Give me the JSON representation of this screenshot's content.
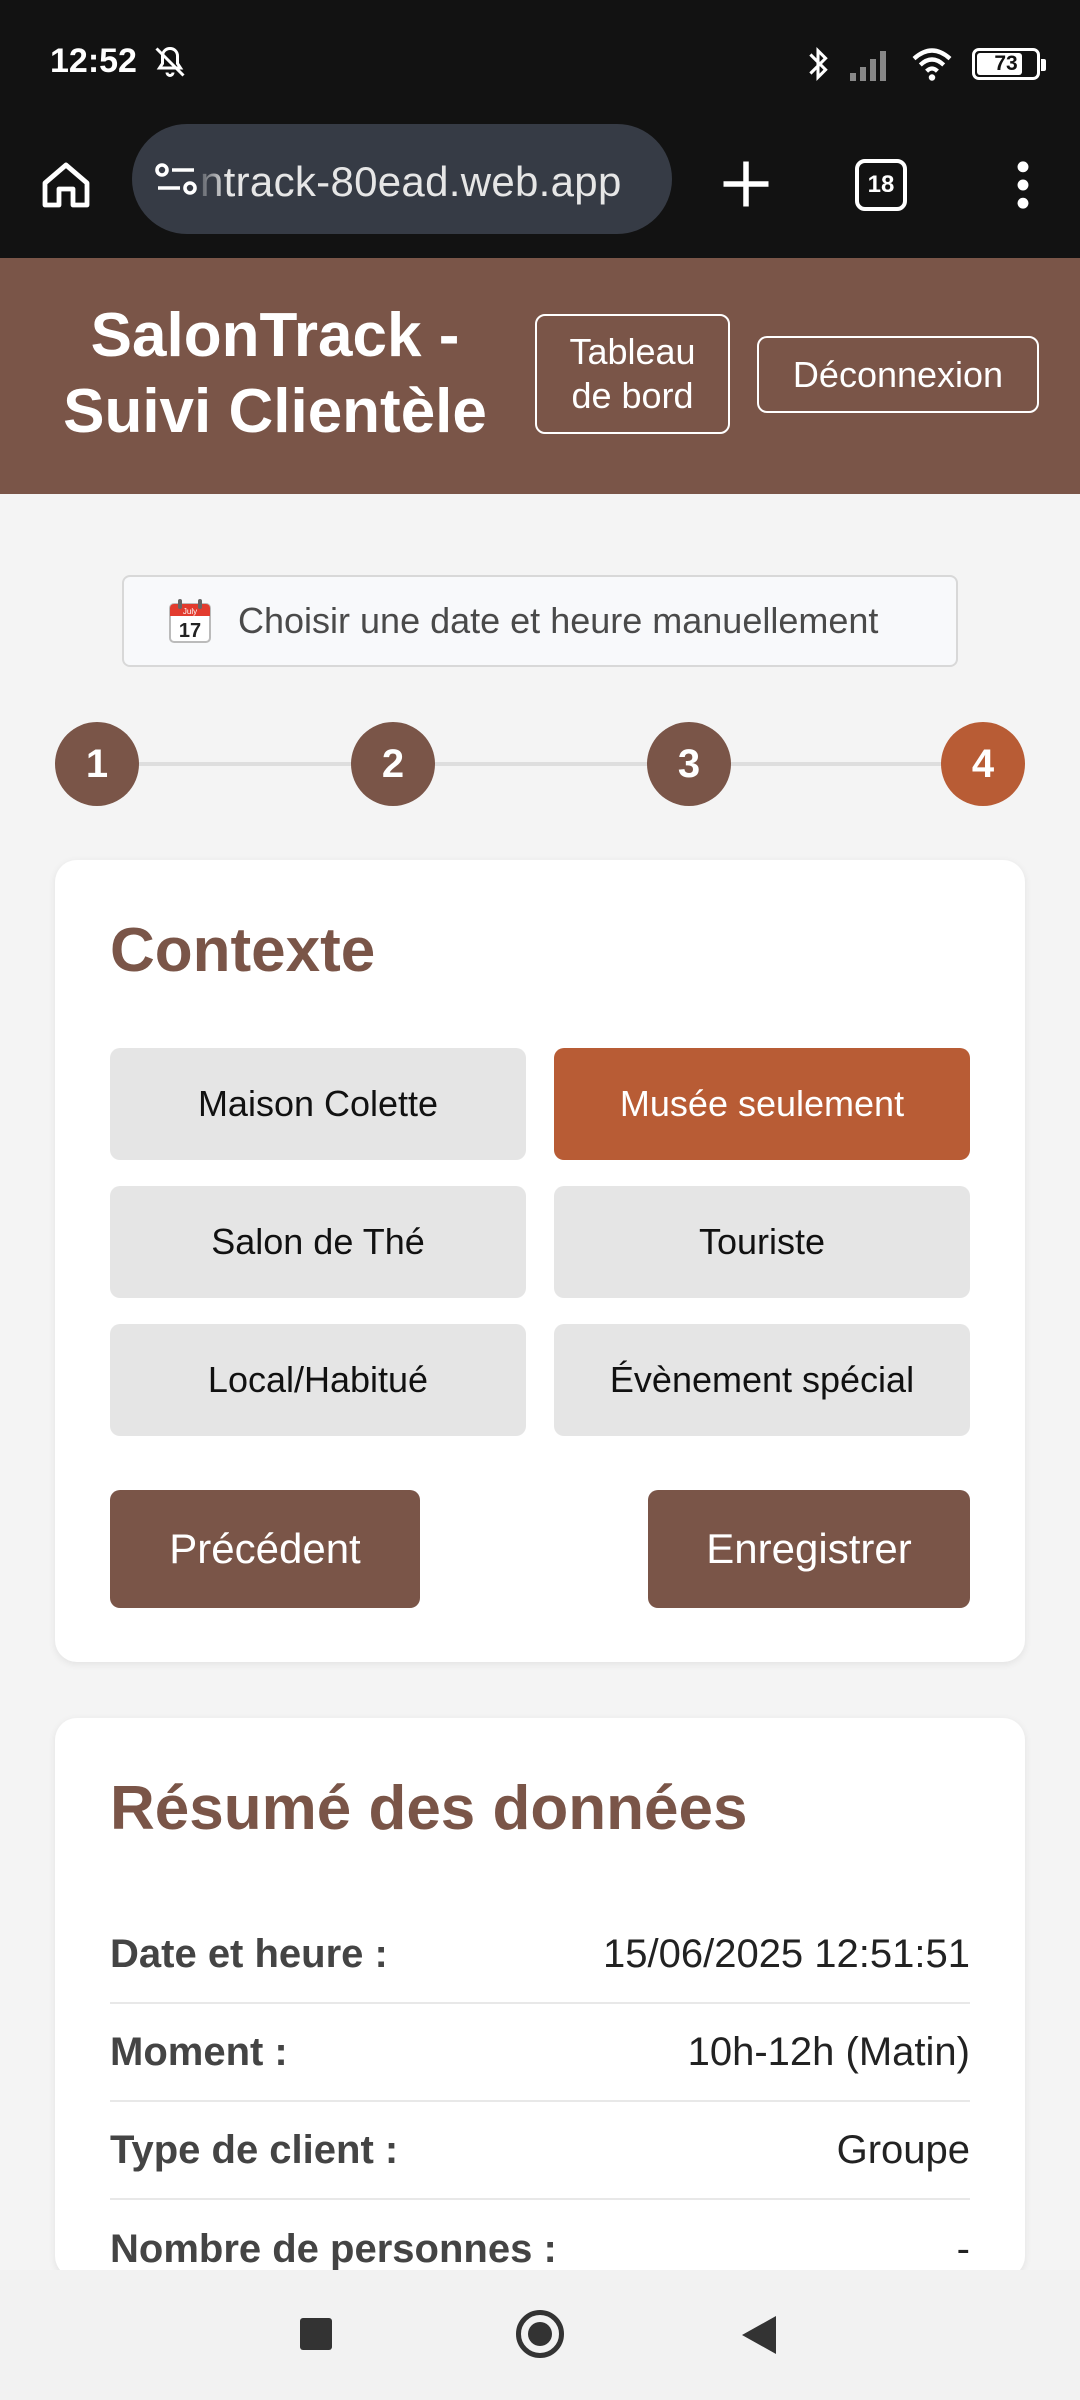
{
  "status_bar": {
    "time": "12:52",
    "left_icons": [
      "notifications-muted-icon"
    ],
    "right_icons": [
      "bluetooth-icon",
      "signal-icon",
      "wifi-icon",
      "battery-icon"
    ],
    "battery_percent": "73"
  },
  "browser": {
    "url": "ntrack-80ead.web.app",
    "tab_count": "18",
    "icons": [
      "home-icon",
      "site-settings-icon",
      "new-tab-icon",
      "tabs-icon",
      "menu-icon"
    ]
  },
  "header": {
    "title_line1": "SalonTrack -",
    "title_line2": "Suivi Clientèle",
    "dashboard_line1": "Tableau",
    "dashboard_line2": "de bord",
    "logout_label": "Déconnexion"
  },
  "manual_date": {
    "icon_month": "July",
    "icon_day": "17",
    "label": "Choisir une date et heure manuellement"
  },
  "stepper": {
    "steps": [
      "1",
      "2",
      "3",
      "4"
    ],
    "active_step": "4"
  },
  "context_card": {
    "title": "Contexte",
    "options": [
      "Maison Colette",
      "Musée seulement",
      "Salon de Thé",
      "Touriste",
      "Local/Habitué",
      "Évènement spécial"
    ],
    "selected": "Musée seulement",
    "prev_label": "Précédent",
    "save_label": "Enregistrer"
  },
  "summary_card": {
    "title": "Résumé des données",
    "rows": [
      {
        "label": "Date et heure :",
        "value": "15/06/2025 12:51:51"
      },
      {
        "label": "Moment :",
        "value": "10h-12h (Matin)"
      },
      {
        "label": "Type de client :",
        "value": "Groupe"
      },
      {
        "label": "Nombre de personnes :",
        "value": "-"
      }
    ]
  },
  "colors": {
    "primary": "#7a5548",
    "accent": "#b85c35",
    "option_bg": "#e5e5e5",
    "page_bg": "#f4f4f4"
  }
}
